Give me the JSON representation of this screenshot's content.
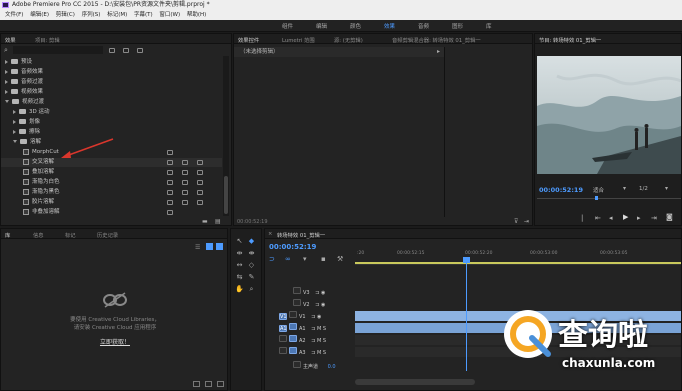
{
  "window": {
    "title": "Adobe Premiere Pro CC 2015 - D:\\安装包\\PR资源文件夹\\剪辑.prproj *"
  },
  "menu": [
    "文件(F)",
    "编辑(E)",
    "剪辑(C)",
    "序列(S)",
    "标记(M)",
    "字幕(T)",
    "窗口(W)",
    "帮助(H)"
  ],
  "workspaces": [
    "组件",
    "编辑",
    "颜色",
    "效果",
    "音频",
    "图形",
    "库"
  ],
  "effects_panel": {
    "tabs": [
      "效果",
      "项目: 剪辑"
    ],
    "search_placeholder": "",
    "tree": [
      {
        "label": "预设",
        "type": "folder",
        "expanded": false
      },
      {
        "label": "音频效果",
        "type": "folder",
        "expanded": false
      },
      {
        "label": "音频过渡",
        "type": "folder",
        "expanded": false
      },
      {
        "label": "视频效果",
        "type": "folder",
        "expanded": false
      },
      {
        "label": "视频过渡",
        "type": "folder",
        "expanded": true
      },
      {
        "label": "3D 运动",
        "type": "folder",
        "expanded": false,
        "indent": 1
      },
      {
        "label": "划像",
        "type": "folder",
        "expanded": false,
        "indent": 1
      },
      {
        "label": "擦除",
        "type": "folder",
        "expanded": false,
        "indent": 1
      },
      {
        "label": "溶解",
        "type": "folder",
        "expanded": true,
        "indent": 1
      },
      {
        "label": "MorphCut",
        "type": "fx",
        "indent": 2
      },
      {
        "label": "交叉溶解",
        "type": "fx",
        "indent": 2,
        "highlight": true
      },
      {
        "label": "叠加溶解",
        "type": "fx",
        "indent": 2
      },
      {
        "label": "渐隐为白色",
        "type": "fx",
        "indent": 2
      },
      {
        "label": "渐隐为黑色",
        "type": "fx",
        "indent": 2
      },
      {
        "label": "胶片溶解",
        "type": "fx",
        "indent": 2
      },
      {
        "label": "非叠加溶解",
        "type": "fx",
        "indent": 2
      }
    ]
  },
  "effect_controls": {
    "tabs": [
      "效果控件",
      "Lumetri 范围",
      "源: (无剪辑)",
      "音频剪辑混合器: 转场特效 01_剪辑一"
    ],
    "empty_text": "（未选择剪辑）",
    "timecode": "00:00:52:19"
  },
  "program_monitor": {
    "tab": "节目: 转场特效 01_剪辑一",
    "timecode": "00:00:52:19",
    "fit_label": "适合",
    "resolution_label": "1/2"
  },
  "project_panel": {
    "tabs": [
      "库",
      "信息",
      "标记",
      "历史记录"
    ],
    "cloud_message_line1": "要使用 Creative Cloud Libraries，",
    "cloud_message_line2": "请安装 Creative Cloud 应用程序",
    "cloud_link": "立即获取！"
  },
  "timeline": {
    "tab": "转场特效 01_剪辑一",
    "timecode": "00:00:52:19",
    "ruler": [
      "00:00:52:15",
      "00:00:52:20",
      "00:00:53:00",
      "00:00:53:05"
    ],
    "tracks": [
      {
        "name": "V3",
        "type": "video"
      },
      {
        "name": "V2",
        "type": "video"
      },
      {
        "name": "V1",
        "type": "video",
        "selected": true
      },
      {
        "name": "A1",
        "type": "audio",
        "selected": true
      },
      {
        "name": "A2",
        "type": "audio",
        "selected": true
      },
      {
        "name": "A3",
        "type": "audio",
        "selected": true
      },
      {
        "name": "主声道",
        "type": "master",
        "value": "0.0"
      }
    ]
  },
  "watermark": {
    "cn": "查询啦",
    "url": "chaxunla.com"
  },
  "colors": {
    "accent": "#4d9bff",
    "clip_video": "#8db3e2",
    "clip_audio": "#8db3e2",
    "playhead": "#4d9bff",
    "arrow": "#d9362c"
  }
}
